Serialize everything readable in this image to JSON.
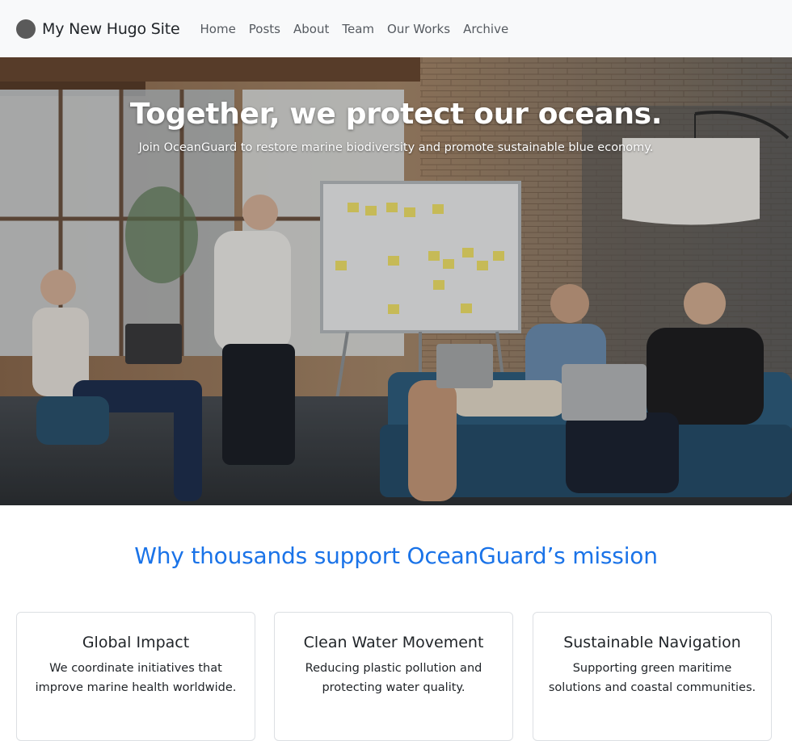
{
  "navbar": {
    "brand": "My New Hugo Site",
    "links": [
      "Home",
      "Posts",
      "About",
      "Team",
      "Our Works",
      "Archive"
    ]
  },
  "hero": {
    "title": "Together, we protect our oceans.",
    "subtitle": "Join OceanGuard to restore marine biodiversity and promote sustainable blue economy."
  },
  "mission": {
    "heading": "Why thousands support OceanGuard’s mission",
    "cards": [
      {
        "title": "Global Impact",
        "text": "We coordinate initiatives that improve marine health worldwide."
      },
      {
        "title": "Clean Water Movement",
        "text": "Reducing plastic pollution and protecting water quality."
      },
      {
        "title": "Sustainable Navigation",
        "text": "Supporting green maritime solutions and coastal communities."
      }
    ]
  },
  "colors": {
    "navbar_bg": "#f8f9fa",
    "heading_blue": "#1a73e8",
    "logo_gray": "#5a5a5a"
  }
}
